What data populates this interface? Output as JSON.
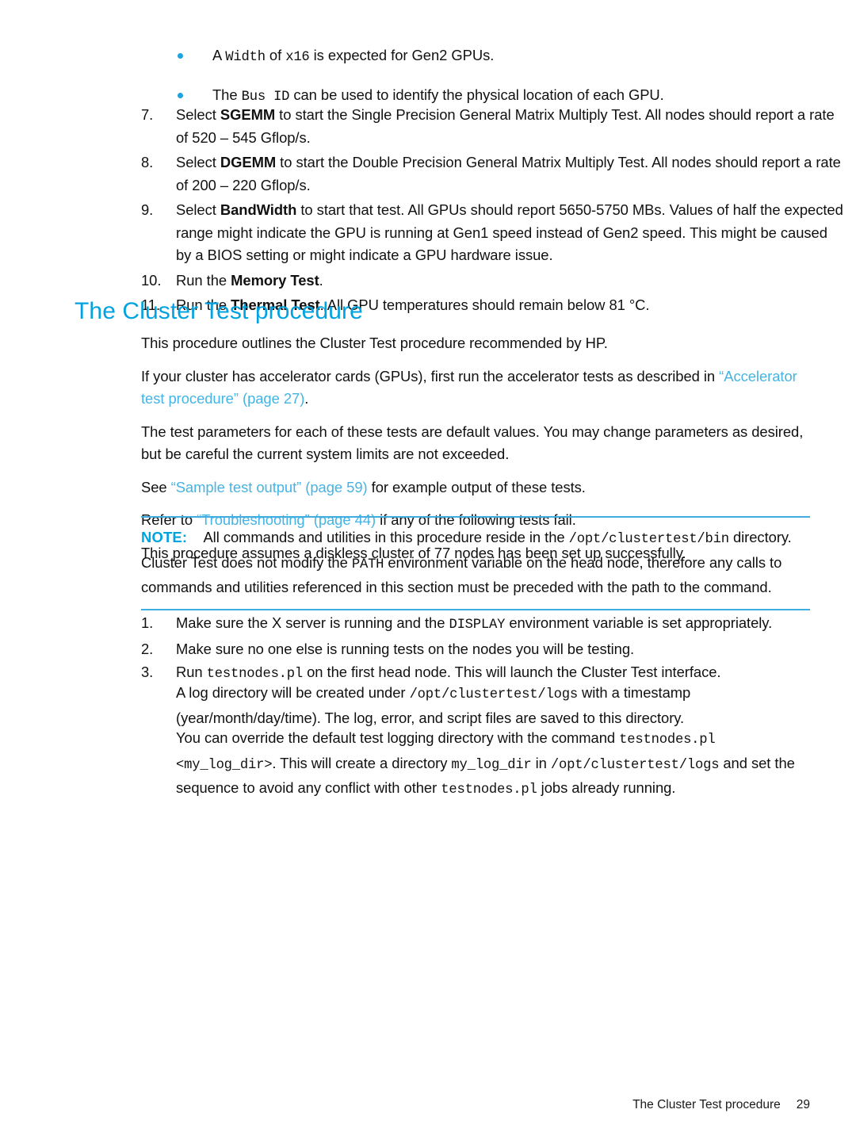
{
  "document": {
    "sub_bullets": [
      {
        "pre": "A ",
        "code1": "Width",
        "mid": " of ",
        "code2": "x16",
        "post": " is expected for Gen2 GPUs."
      },
      {
        "pre": "The ",
        "code1": "Bus ID",
        "mid": "",
        "code2": "",
        "post": " can be used to identify the physical location of each GPU."
      }
    ],
    "steps_continued": [
      {
        "number": "7.",
        "seg_a": "Select ",
        "bold": "SGEMM",
        "seg_b": " to start the Single Precision General Matrix Multiply Test. All nodes should report a rate of 520 – 545 Gflop/s."
      },
      {
        "number": "8.",
        "seg_a": "Select ",
        "bold": "DGEMM",
        "seg_b": " to start the Double Precision General Matrix Multiply Test. All nodes should report a rate of 200 – 220 Gflop/s."
      },
      {
        "number": "9.",
        "seg_a": "Select ",
        "bold": "BandWidth",
        "seg_b": " to start that test. All GPUs should report 5650-5750 MBs. Values of half the expected range might indicate the GPU is running at Gen1 speed instead of Gen2 speed. This might be caused by a BIOS setting or might indicate a GPU hardware issue."
      },
      {
        "number": "10.",
        "seg_a": "Run the ",
        "bold": "Memory Test",
        "seg_b": "."
      },
      {
        "number": "11.",
        "seg_a": "Run the ",
        "bold": "Thermal Test",
        "seg_b": ". All GPU temperatures should remain below 81 °C."
      }
    ],
    "section": {
      "heading": "The Cluster Test procedure",
      "para1": "This procedure outlines the Cluster Test procedure recommended by HP.",
      "para2_a": "If your cluster has accelerator cards (GPUs), first run the accelerator tests as described in ",
      "para2_link": "“Accelerator test procedure” (page 27)",
      "para2_b": ".",
      "para3": "The test parameters for each of these tests are default values. You may change parameters as desired, but be careful the current system limits are not exceeded.",
      "para4_a": "See ",
      "para4_link": "“Sample test output” (page 59)",
      "para4_b": " for example output of these tests.",
      "para5_a": "Refer to ",
      "para5_link": "“Troubleshooting” (page 44)",
      "para5_b": " if any of the following tests fail.",
      "para6": "This procedure assumes a diskless cluster of 77 nodes has been set up successfully."
    },
    "note": {
      "label": "NOTE:",
      "seg_a": "All commands and utilities in this procedure reside in the ",
      "code1": "/opt/clustertest/bin",
      "seg_b": " directory. Cluster Test does not modify the ",
      "code2": "PATH",
      "seg_c": " environment variable on the head node, therefore any calls to commands and utilities referenced in this section must be preceded with the path to the command."
    },
    "steps_new": [
      {
        "number": "1.",
        "seg_a": "Make sure the X server is running and the ",
        "code": "DISPLAY",
        "seg_b": " environment variable is set appropriately."
      },
      {
        "number": "2.",
        "seg_a": "Make sure no one else is running tests on the nodes you will be testing.",
        "code": "",
        "seg_b": ""
      },
      {
        "number": "3.",
        "seg_a": "Run ",
        "code": "testnodes.pl",
        "seg_b": " on the first head node. This will launch the Cluster Test interface."
      }
    ],
    "continuation": {
      "p1_a": "A log directory will be created under ",
      "p1_code": "/opt/clustertest/logs",
      "p1_b": " with a timestamp (year/month/day/time). The log, error, and script files are saved to this directory.",
      "p2_a": "You can override the default test logging directory with the command ",
      "p2_code1": "testnodes.pl <my_log_dir>",
      "p2_b": ". This will create a directory ",
      "p2_code2": "my_log_dir",
      "p2_c": " in ",
      "p2_code3": "/opt/clustertest/logs",
      "p2_d": " and set the sequence to avoid any conflict with other ",
      "p2_code4": "testnodes.pl",
      "p2_e": " jobs already running."
    },
    "footer": {
      "title": "The Cluster Test procedure",
      "page_number": "29"
    },
    "colors": {
      "heading_blue": "#00A3DF",
      "link_blue": "#45B4E4",
      "bullet_blue": "#1DA4DE",
      "rule_blue": "#3FADE0"
    }
  }
}
